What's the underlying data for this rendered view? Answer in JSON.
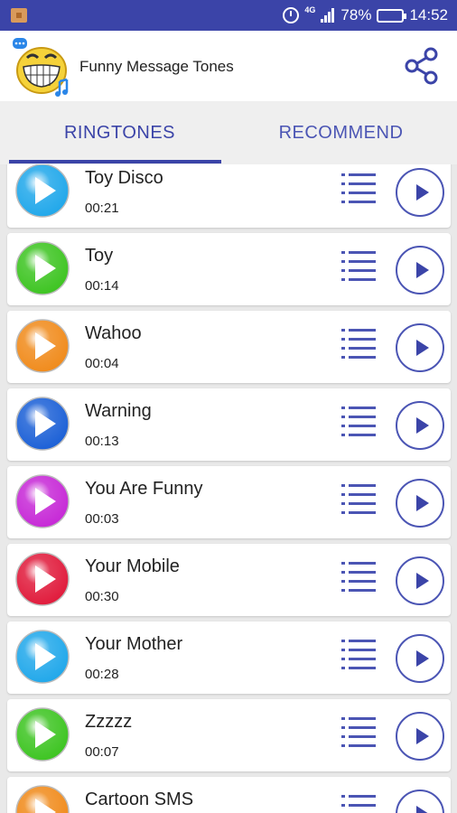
{
  "status_bar": {
    "network_label": "4G",
    "battery_text": "78%",
    "battery_level": 0.78,
    "time": "14:52"
  },
  "app_bar": {
    "title": "Funny Message Tones"
  },
  "tabs": [
    {
      "label": "RINGTONES",
      "active": true
    },
    {
      "label": "RECOMMEND",
      "active": false
    }
  ],
  "ringtones": [
    {
      "name": "Toy Disco",
      "duration": "00:21",
      "ball_color": "#1fa7ea"
    },
    {
      "name": "Toy",
      "duration": "00:14",
      "ball_color": "#3cc420"
    },
    {
      "name": "Wahoo",
      "duration": "00:04",
      "ball_color": "#f08a1a"
    },
    {
      "name": "Warning",
      "duration": "00:13",
      "ball_color": "#1a5fd6"
    },
    {
      "name": "You Are Funny",
      "duration": "00:03",
      "ball_color": "#c627d6"
    },
    {
      "name": "Your Mobile",
      "duration": "00:30",
      "ball_color": "#e0193a"
    },
    {
      "name": "Your Mother",
      "duration": "00:28",
      "ball_color": "#1fa7ea"
    },
    {
      "name": "Zzzzz",
      "duration": "00:07",
      "ball_color": "#3cc420"
    },
    {
      "name": "Cartoon SMS",
      "duration": "",
      "ball_color": "#f08a1a"
    }
  ],
  "colors": {
    "primary": "#3b44a8",
    "accent": "#4b55b4"
  }
}
